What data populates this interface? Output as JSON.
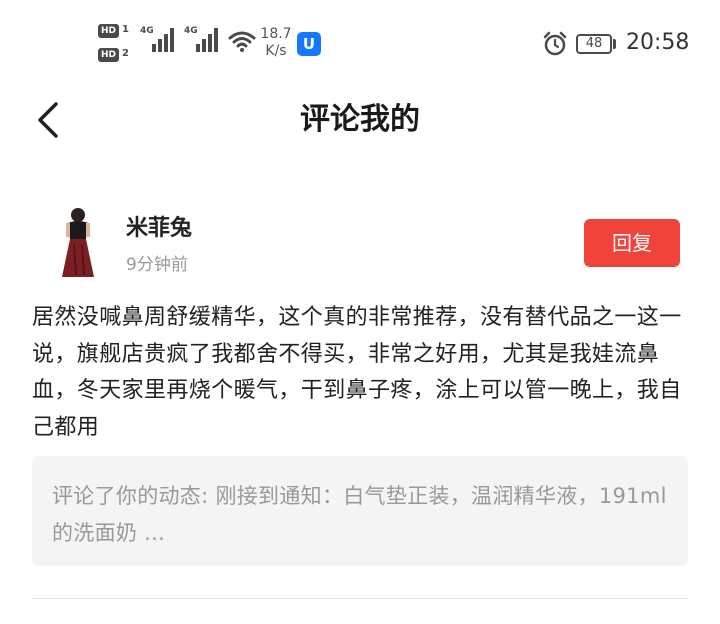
{
  "status_bar": {
    "hd1": "HD",
    "hd2": "HD",
    "sim1": "1",
    "sim2": "2",
    "net1": "4G",
    "net2": "4G",
    "speed_value": "18.7",
    "speed_unit": "K/s",
    "app_icon_glyph": "U",
    "battery": "48",
    "time": "20:58",
    "icons": [
      "signal-icon",
      "wifi-icon",
      "alarm-icon",
      "battery-icon"
    ]
  },
  "header": {
    "title": "评论我的",
    "back_icon": "back-arrow-icon"
  },
  "comment": {
    "username": "米菲兔",
    "time_ago": "9分钟前",
    "reply_label": "回复",
    "text": "居然没喊鼻周舒缓精华，这个真的非常推荐，没有替代品之一这一说，旗舰店贵疯了我都舍不得买，非常之好用，尤其是我娃流鼻血，冬天家里再烧个暖气，干到鼻子疼，涂上可以管一晚上，我自己都用",
    "quote": "评论了你的动态: 刚接到通知：白气垫正装，温润精华液，191ml的洗面奶 ...",
    "accent_color": "#f0433a"
  }
}
